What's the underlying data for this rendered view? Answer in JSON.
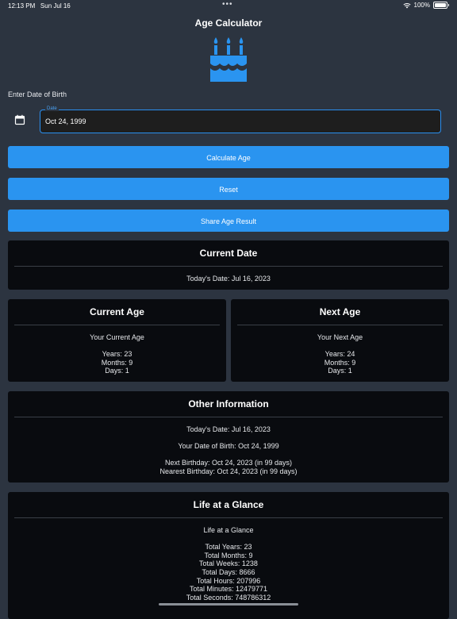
{
  "status": {
    "time": "12:13 PM",
    "date": "Sun Jul 16",
    "dots": "•••",
    "battery": "100%"
  },
  "app": {
    "title": "Age Calculator"
  },
  "form": {
    "dob_label": "Enter Date of Birth",
    "date_field_label": "Date",
    "date_value": "Oct 24, 1999"
  },
  "buttons": {
    "calculate": "Calculate Age",
    "reset": "Reset",
    "share": "Share Age Result"
  },
  "current_date": {
    "title": "Current Date",
    "today": "Today's Date: Jul 16, 2023"
  },
  "current_age": {
    "title": "Current Age",
    "subtitle": "Your Current Age",
    "years": "Years: 23",
    "months": "Months: 9",
    "days": "Days: 1"
  },
  "next_age": {
    "title": "Next Age",
    "subtitle": "Your Next Age",
    "years": "Years: 24",
    "months": "Months: 9",
    "days": "Days: 1"
  },
  "other": {
    "title": "Other Information",
    "today": "Today's Date: Jul 16, 2023",
    "dob": "Your Date of Birth: Oct 24, 1999",
    "next_birthday": "Next Birthday: Oct 24, 2023 (in 99 days)",
    "nearest_birthday": "Nearest Birthday: Oct 24, 2023 (in 99 days)"
  },
  "glance": {
    "title": "Life at a Glance",
    "subtitle": "Life at a Glance",
    "years": "Total Years: 23",
    "months": "Total Months: 9",
    "weeks": "Total Weeks: 1238",
    "days": "Total Days: 8666",
    "hours": "Total Hours: 207996",
    "minutes": "Total Minutes: 12479771",
    "seconds": "Total Seconds: 748786312"
  },
  "icons": {
    "app": "birthday-cake-icon",
    "date_picker": "calendar-icon",
    "wifi": "wifi-icon",
    "battery": "battery-icon"
  },
  "colors": {
    "background": "#2c3440",
    "accent": "#2a94f0",
    "card": "#090b0f"
  }
}
